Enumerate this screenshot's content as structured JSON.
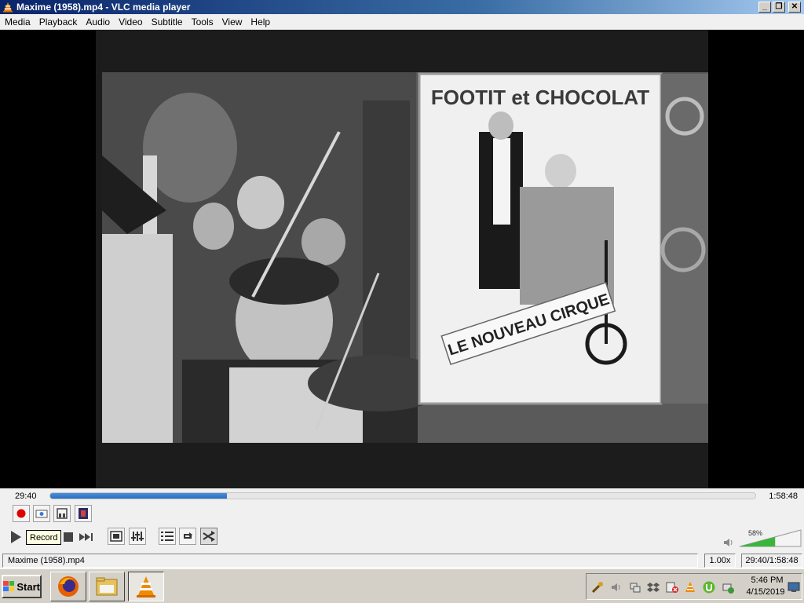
{
  "window": {
    "title": "Maxime (1958).mp4 - VLC media player",
    "minimize_glyph": "_",
    "restore_glyph": "❐",
    "close_glyph": "✕"
  },
  "menu": [
    "Media",
    "Playback",
    "Audio",
    "Video",
    "Subtitle",
    "Tools",
    "View",
    "Help"
  ],
  "video": {
    "poster_title": "FOOTIT et CHOCOLAT",
    "banner_text": "LE NOUVEAU CIRQUE"
  },
  "seek": {
    "elapsed": "29:40",
    "total": "1:58:48",
    "progress": 0.25
  },
  "advanced_controls": [
    {
      "name": "record-icon",
      "label": "Record"
    },
    {
      "name": "snapshot-icon",
      "label": "Snapshot"
    },
    {
      "name": "loop-ab-icon",
      "label": "Loop A-B"
    },
    {
      "name": "frame-by-frame-icon",
      "label": "Frame by frame"
    }
  ],
  "tooltip": "Record",
  "volume": {
    "percent": 58,
    "label": "58%"
  },
  "status": {
    "filename": "Maxime (1958).mp4",
    "speed": "1.00x",
    "time": "29:40/1:58:48"
  },
  "taskbar": {
    "start_label": "Start",
    "clock_time": "5:46 PM",
    "clock_date": "4/15/2019"
  },
  "colors": {
    "accent": "#2a6cc0",
    "record": "#e00000",
    "volume": "#3cb43c"
  }
}
